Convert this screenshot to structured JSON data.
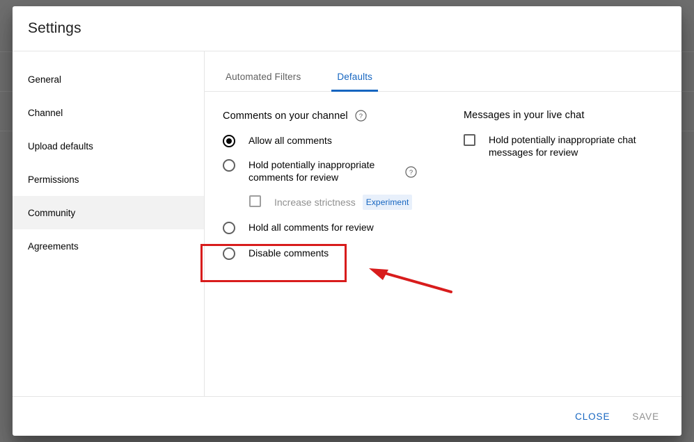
{
  "dialog": {
    "title": "Settings"
  },
  "sidebar": {
    "items": [
      {
        "label": "General"
      },
      {
        "label": "Channel"
      },
      {
        "label": "Upload defaults"
      },
      {
        "label": "Permissions"
      },
      {
        "label": "Community"
      },
      {
        "label": "Agreements"
      }
    ]
  },
  "tabs": [
    {
      "label": "Automated Filters"
    },
    {
      "label": "Defaults"
    }
  ],
  "comments_section": {
    "title": "Comments on your channel",
    "help_icon": "help-circle-icon",
    "options": [
      {
        "label": "Allow all comments"
      },
      {
        "label": "Hold potentially inappropriate comments for review"
      },
      {
        "label": "Hold all comments for review"
      },
      {
        "label": "Disable comments"
      }
    ],
    "strictness": {
      "label": "Increase strictness",
      "badge": "Experiment"
    }
  },
  "livechat_section": {
    "title": "Messages in your live chat",
    "option_label": "Hold potentially inappropriate chat messages for review"
  },
  "footer": {
    "close_label": "CLOSE",
    "save_label": "SAVE"
  },
  "colors": {
    "accent_blue": "#1565c0",
    "annotation_red": "#d81c1c",
    "selected_row": "#f2f2f2",
    "disabled_text": "#909090"
  }
}
